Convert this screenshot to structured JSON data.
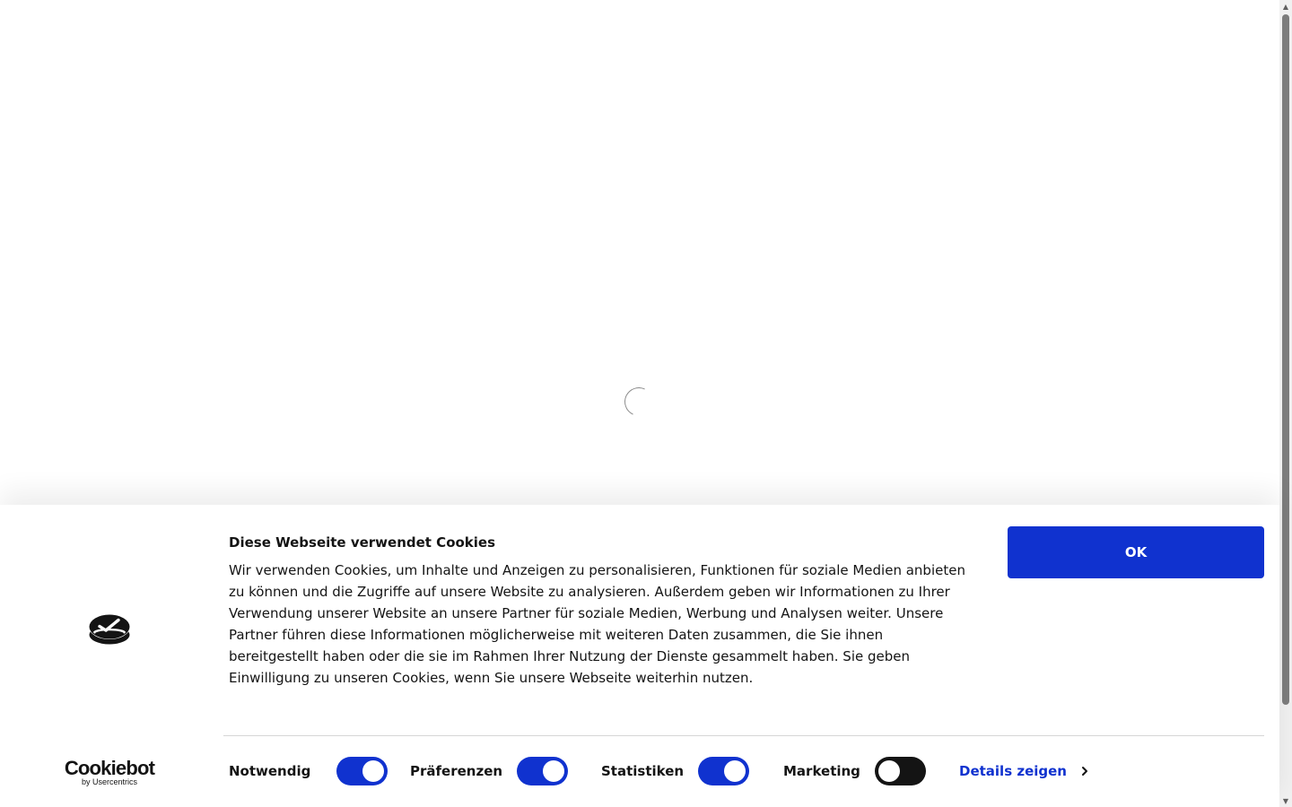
{
  "banner": {
    "title": "Diese Webseite verwendet Cookies",
    "body": "Wir verwenden Cookies, um Inhalte und Anzeigen zu personalisieren, Funktionen für soziale Medien anbieten zu können und die Zugriffe auf unsere Website zu analysieren. Außerdem geben wir Informationen zu Ihrer Verwendung unserer Website an unsere Partner für soziale Medien, Werbung und Analysen weiter. Unsere Partner führen diese Informationen möglicherweise mit weiteren Daten zusammen, die Sie ihnen bereitgestellt haben oder die sie im Rahmen Ihrer Nutzung der Dienste gesammelt haben. Sie geben Einwilligung zu unseren Cookies, wenn Sie unsere Webseite weiterhin nutzen.",
    "ok_label": "OK",
    "brand_name": "Cookiebot",
    "brand_sub": "by Usercentrics",
    "details_label": "Details zeigen",
    "toggles": [
      {
        "label": "Notwendig",
        "checked": true
      },
      {
        "label": "Präferenzen",
        "checked": true
      },
      {
        "label": "Statistiken",
        "checked": true
      },
      {
        "label": "Marketing",
        "checked": false
      }
    ]
  },
  "icons": {
    "logo": "cookiebot-logo-icon",
    "spinner": "loading-spinner-icon",
    "chevron": "chevron-right-icon"
  },
  "colors": {
    "accent": "#1032cf",
    "text": "#141414",
    "switch_off": "#141414",
    "divider": "#d6d6d6"
  }
}
